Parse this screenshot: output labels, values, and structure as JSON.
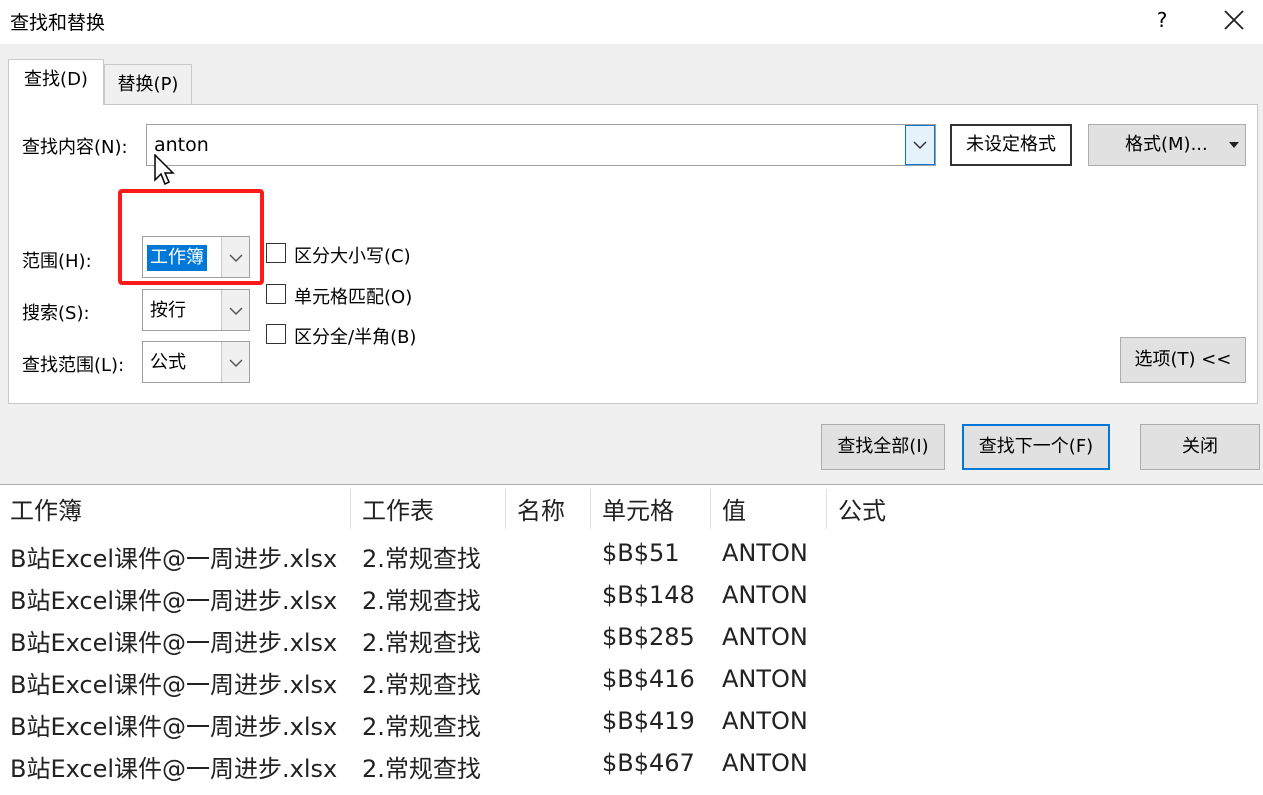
{
  "dialog": {
    "title": "查找和替换",
    "help_label": "?",
    "close_icon": "close-icon"
  },
  "tabs": [
    {
      "label": "查找(D)",
      "active": true
    },
    {
      "label": "替换(P)",
      "active": false
    }
  ],
  "find": {
    "label": "查找内容(N):",
    "value": "anton",
    "no_format_label": "未设定格式",
    "format_label": "格式(M)..."
  },
  "options": {
    "within_label": "范围(H):",
    "within_value": "工作簿",
    "search_label": "搜索(S):",
    "search_value": "按行",
    "lookin_label": "查找范围(L):",
    "lookin_value": "公式",
    "match_case_label": "区分大小写(C)",
    "match_cell_label": "单元格匹配(O)",
    "match_byte_label": "区分全/半角(B)",
    "options_button_label": "选项(T) <<"
  },
  "actions": {
    "find_all": "查找全部(I)",
    "find_next": "查找下一个(F)",
    "close": "关闭"
  },
  "results": {
    "columns": [
      "工作簿",
      "工作表",
      "名称",
      "单元格",
      "值",
      "公式"
    ],
    "rows": [
      {
        "book": "B站Excel课件@一周进步.xlsx",
        "sheet": "2.常规查找",
        "name": "",
        "cell": "$B$51",
        "value": "ANTON",
        "formula": ""
      },
      {
        "book": "B站Excel课件@一周进步.xlsx",
        "sheet": "2.常规查找",
        "name": "",
        "cell": "$B$148",
        "value": "ANTON",
        "formula": ""
      },
      {
        "book": "B站Excel课件@一周进步.xlsx",
        "sheet": "2.常规查找",
        "name": "",
        "cell": "$B$285",
        "value": "ANTON",
        "formula": ""
      },
      {
        "book": "B站Excel课件@一周进步.xlsx",
        "sheet": "2.常规查找",
        "name": "",
        "cell": "$B$416",
        "value": "ANTON",
        "formula": ""
      },
      {
        "book": "B站Excel课件@一周进步.xlsx",
        "sheet": "2.常规查找",
        "name": "",
        "cell": "$B$419",
        "value": "ANTON",
        "formula": ""
      },
      {
        "book": "B站Excel课件@一周进步.xlsx",
        "sheet": "2.常规查找",
        "name": "",
        "cell": "$B$467",
        "value": "ANTON",
        "formula": ""
      }
    ]
  },
  "colors": {
    "highlight_box": "#ff1a1a",
    "selection": "#0078d7"
  }
}
